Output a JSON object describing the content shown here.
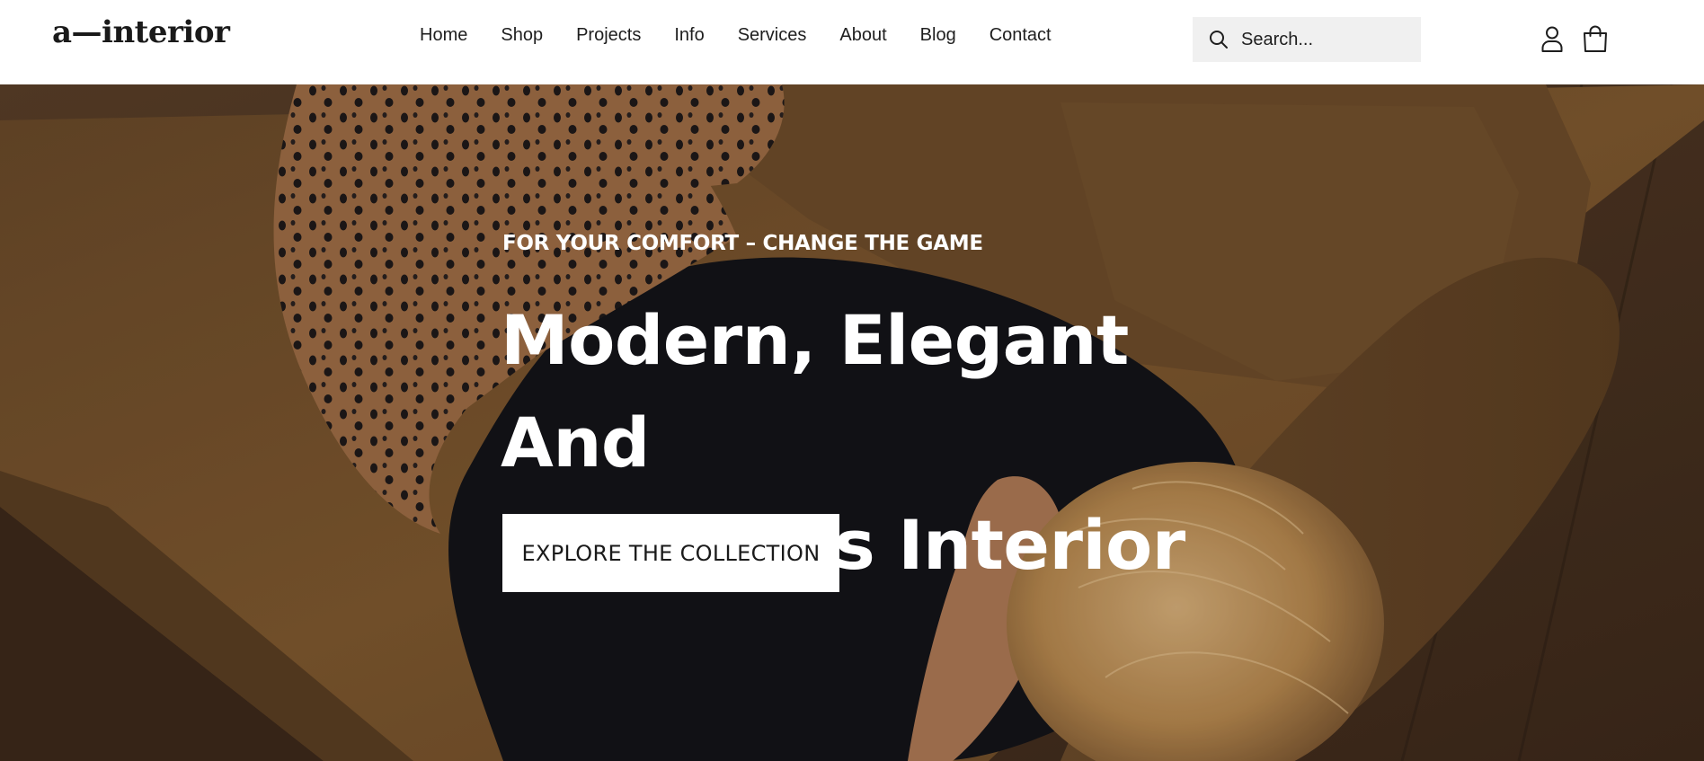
{
  "brand": {
    "logo_text": "a—interior"
  },
  "nav": {
    "items": [
      {
        "label": "Home"
      },
      {
        "label": "Shop"
      },
      {
        "label": "Projects"
      },
      {
        "label": "Info"
      },
      {
        "label": "Services"
      },
      {
        "label": "About"
      },
      {
        "label": "Blog"
      },
      {
        "label": "Contact"
      }
    ]
  },
  "search": {
    "placeholder": "Search...",
    "value": "",
    "icon": "search-icon"
  },
  "header_icons": {
    "account": "user-icon",
    "cart": "shopping-bag-icon"
  },
  "hero": {
    "eyebrow": "FOR YOUR COMFORT – CHANGE THE GAME",
    "title_line1": "Modern, Elegant And",
    "title_line2": "Luxurious Interior",
    "cta_label": "EXPLORE THE COLLECTION"
  },
  "colors": {
    "header_bg": "#ffffff",
    "search_bg": "#f0f0f0",
    "text_dark": "#1e1e1e",
    "hero_text": "#ffffff",
    "sofa": "#7a5530",
    "floor": "#4e3724",
    "garment": "#15151a"
  }
}
